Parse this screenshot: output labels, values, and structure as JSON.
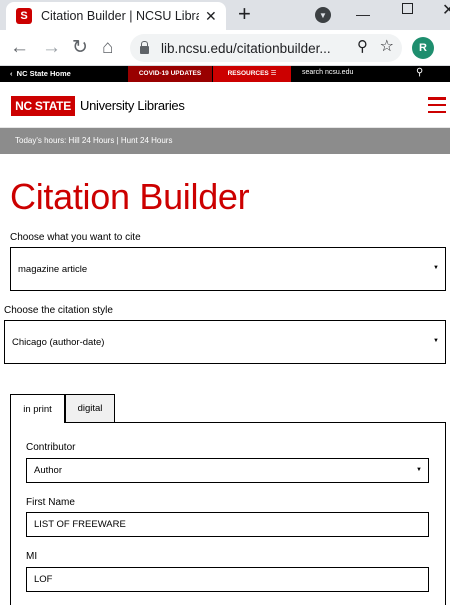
{
  "browser": {
    "tab_title": "Citation Builder | NCSU Libraries",
    "tab_favicon": "S",
    "url": "lib.ncsu.edu/citationbuilder...",
    "profile_initial": "R"
  },
  "global_bar": {
    "home_label": "NC State Home",
    "covid_label": "COVID-19 UPDATES",
    "resources_label": "RESOURCES",
    "search_label": "search ncsu.edu"
  },
  "header": {
    "logo_text": "NC STATE",
    "library_name": "University Libraries"
  },
  "hours": "Today's hours: Hill 24 Hours | Hunt 24 Hours",
  "page": {
    "title": "Citation Builder",
    "cite_label": "Choose what you want to cite",
    "cite_value": "magazine article",
    "style_label": "Choose the citation style",
    "style_value": "Chicago (author-date)"
  },
  "tabs": [
    "in print",
    "digital"
  ],
  "form": {
    "contributor_label": "Contributor",
    "contributor_value": "Author",
    "first_name_label": "First Name",
    "first_name_value": "LIST OF FREEWARE",
    "mi_label": "MI",
    "mi_value": "LOF"
  },
  "colors": {
    "brand_red": "#cc0000",
    "dark_red": "#990000",
    "hours_gray": "#8c8c8c"
  }
}
